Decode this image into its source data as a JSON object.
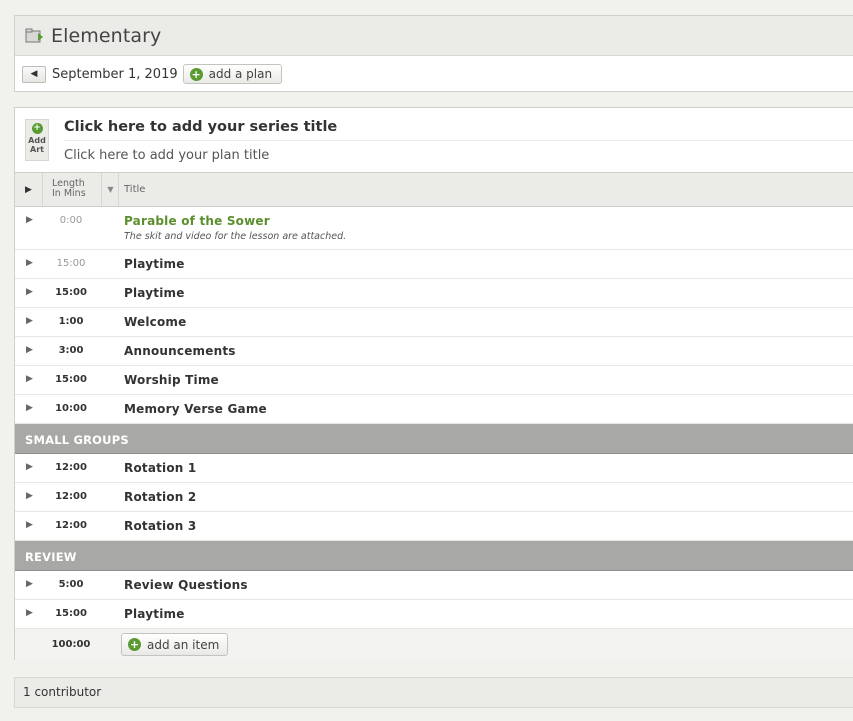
{
  "header": {
    "title": "Elementary",
    "date": "September 1, 2019",
    "add_plan_label": "add a plan"
  },
  "plan": {
    "add_art_label_1": "Add",
    "add_art_label_2": "Art",
    "series_title": "Click here to add your series title",
    "plan_title": "Click here to add your plan title",
    "columns": {
      "length_line1": "Length",
      "length_line2": "In Mins",
      "title": "Title"
    },
    "items": [
      {
        "length": "0:00",
        "title": "Parable of the Sower",
        "note": "The skit and video for the lesson are attached."
      },
      {
        "length": "15:00",
        "title": "Playtime"
      },
      {
        "length": "15:00",
        "title": "Playtime"
      },
      {
        "length": "1:00",
        "title": "Welcome"
      },
      {
        "length": "3:00",
        "title": "Announcements"
      },
      {
        "length": "15:00",
        "title": "Worship Time"
      },
      {
        "length": "10:00",
        "title": "Memory Verse Game"
      }
    ],
    "section_small_groups": "SMALL GROUPS",
    "small_groups": [
      {
        "length": "12:00",
        "title": "Rotation 1"
      },
      {
        "length": "12:00",
        "title": "Rotation 2"
      },
      {
        "length": "12:00",
        "title": "Rotation 3"
      }
    ],
    "section_review": "REVIEW",
    "review": [
      {
        "length": "5:00",
        "title": "Review Questions"
      },
      {
        "length": "15:00",
        "title": "Playtime"
      }
    ],
    "total_length": "100:00",
    "add_item_label": "add an item"
  },
  "footer": {
    "contributors": "1 contributor"
  },
  "colors": {
    "accent_green": "#5a9a32",
    "section_gray": "#a8a8a6"
  }
}
